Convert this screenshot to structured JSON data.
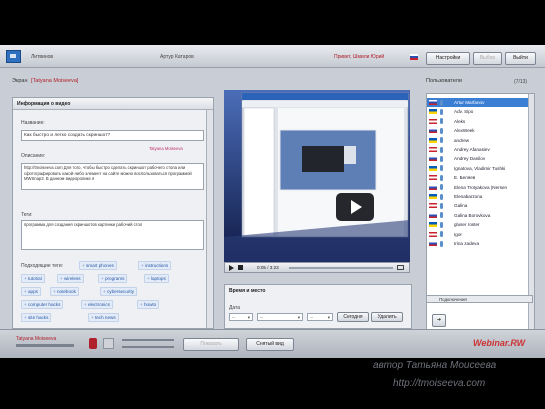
{
  "topbar": {
    "nav_label": "Литвинов",
    "user_name": "Артур Катаров",
    "greeting": "Привет, Шмили Юрий",
    "buttons": {
      "settings": "Настройки",
      "hidden": "Выбор",
      "exit": "Выйти"
    }
  },
  "screen_panel": {
    "title_prefix": "Экран",
    "presenter": "[Tatyana Moiseeva]",
    "info_title": "Информация о видео"
  },
  "form": {
    "title_label": "Название:",
    "title_value": "Как быстро и легко создать скриншот?",
    "presenter_tag": "Tatyana Moiseeva",
    "description_label": "Описание:",
    "description_value": "http://tmoiseeva.com Для того, чтобы быстро сделать скриншот рабочего стола или сфотографировать какой-либо элемент на сайте можно воспользоваться программой MWSnap3. В данном видеоролике я",
    "tags_label": "Теги:",
    "tags_value": "программа для создания скриншотов картинки рабочий стол",
    "suggested_label": "Подходящие теги:",
    "suggested_tags": [
      "smart phones",
      "instructions",
      "tutorial",
      "wireless",
      "programs",
      "laptops",
      "apps",
      "notebook",
      "cybersecurity",
      "computer hacks",
      "electronics",
      "howto",
      "site hacks",
      "tech news"
    ]
  },
  "player": {
    "time": "0:05 / 3:23"
  },
  "schedule": {
    "title": "Время и место",
    "date_label": "Дата",
    "date_placeholders": [
      "--",
      "--",
      "--"
    ],
    "today_button": "Сегодня",
    "delete_button": "Удалить"
  },
  "users_panel": {
    "title": "Пользователи",
    "count": "(7/13)",
    "users": [
      "Artur Marfanov",
      "Adv. Sipo",
      "Aleks",
      "AlexWeek",
      "andrew",
      "Andrey Afanasiev",
      "Andrey Danilov",
      "Ignatova, Vladimir Tushki",
      "E. Беляев",
      "Elena Trotyakova (Nersen",
      "Elenabarzona",
      "Galina",
      "Galina Borovkova",
      "gluser roster",
      "Igor",
      "Irina zadeva"
    ],
    "footer_label": "Подключения"
  },
  "bottombar": {
    "presenter_name": "Tatyana Moiseeva",
    "camera_button": "Показать",
    "clear_button": "Снятый вид"
  },
  "watermark": {
    "brand": "Webinar.RW",
    "author": "автор Татьяна Моисеева",
    "url": "http://tmoiseeva.com"
  },
  "colors": {
    "accent_red": "#b0202a",
    "link_blue": "#2a5aa8",
    "selection": "#3b7fd4"
  }
}
